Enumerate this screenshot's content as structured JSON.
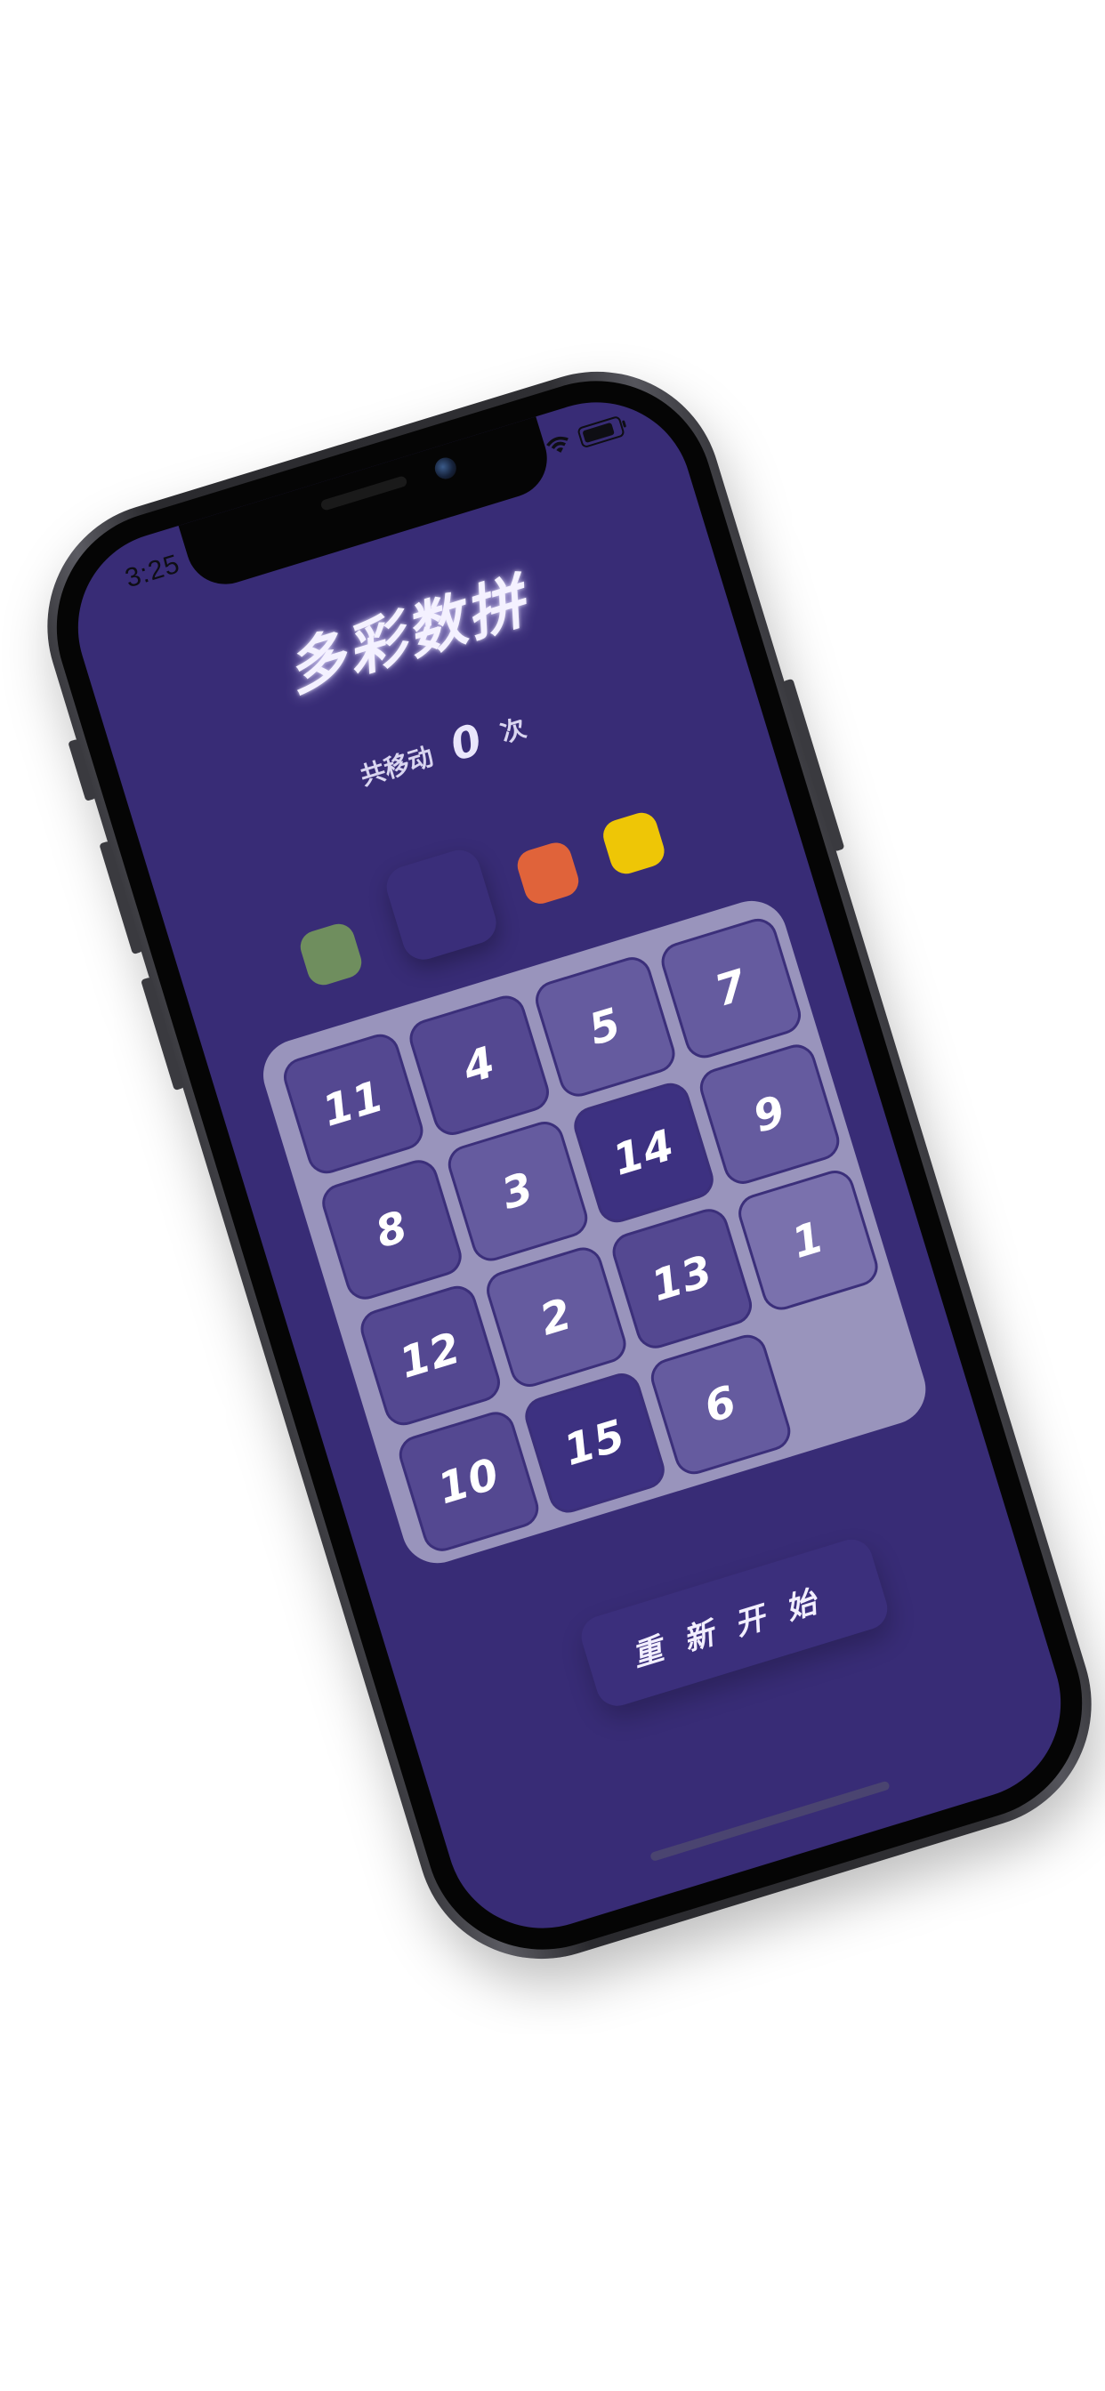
{
  "status_bar": {
    "time": "3:25"
  },
  "game": {
    "title": "多彩数拼",
    "moves_prefix": "共移动",
    "moves_count": "0",
    "moves_suffix": "次",
    "restart_label": "重新开始"
  },
  "color_swatches": [
    {
      "name": "green",
      "color": "#6f8e5e"
    },
    {
      "name": "dark-purple",
      "color": "#3a2e7a"
    },
    {
      "name": "orange",
      "color": "#e0633a"
    },
    {
      "name": "yellow",
      "color": "#eec606"
    }
  ],
  "board": {
    "rows": [
      [
        "11",
        "4",
        "5",
        "7"
      ],
      [
        "8",
        "3",
        "14",
        "9"
      ],
      [
        "12",
        "2",
        "13",
        "1"
      ],
      [
        "10",
        "15",
        "6",
        ""
      ]
    ]
  },
  "colors": {
    "background": "#382c76",
    "board": "#9994bc",
    "title_glow": "#d2c8ff"
  },
  "icons": [
    "wifi-icon",
    "battery-icon",
    "signal-icon",
    "camera-icon"
  ]
}
